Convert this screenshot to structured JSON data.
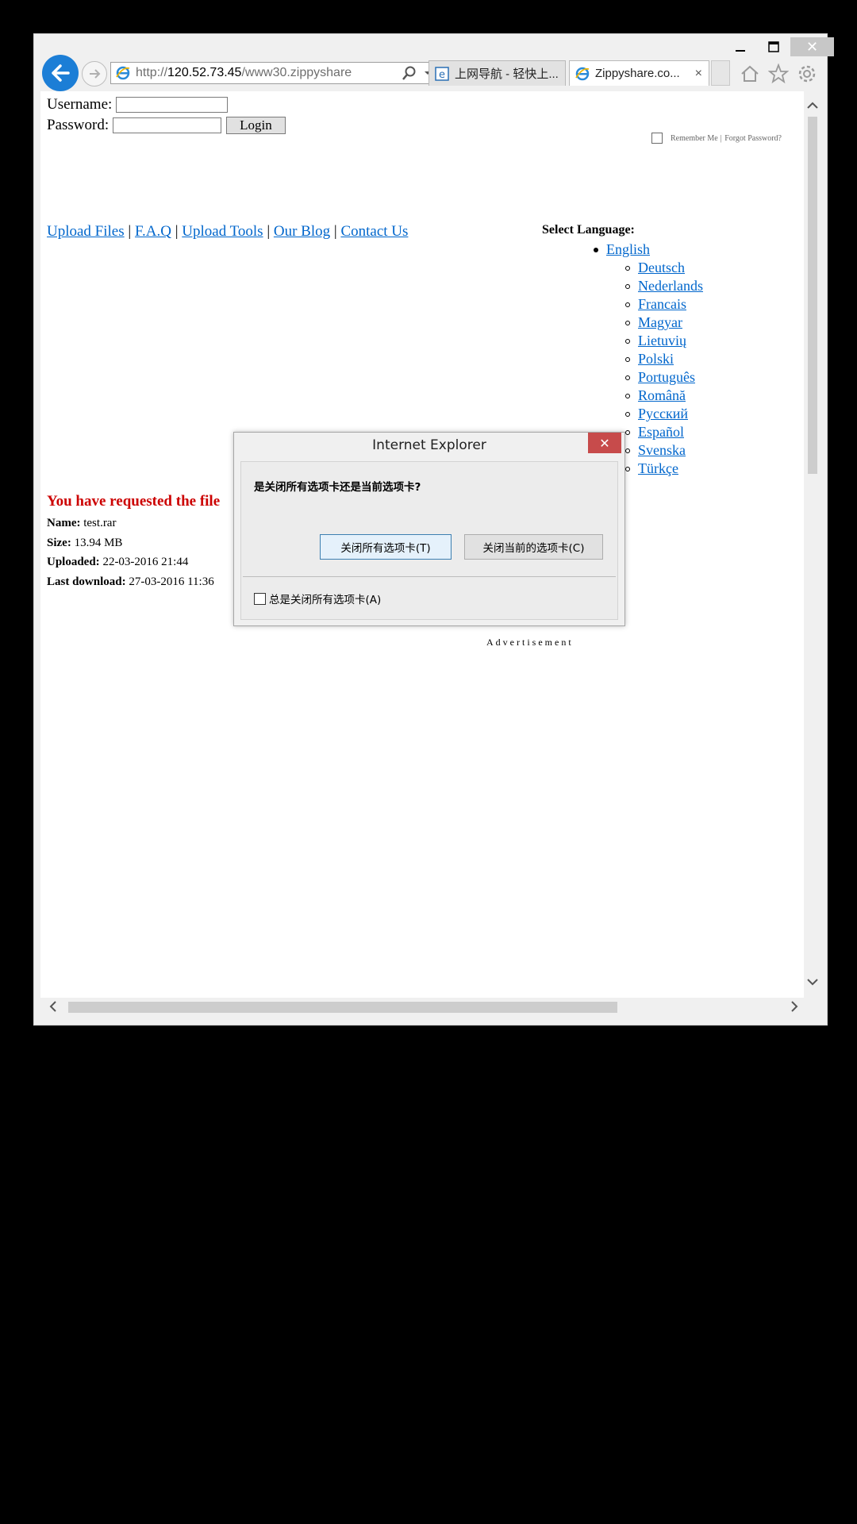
{
  "browser": {
    "address": {
      "url_prefix": "http://",
      "url_host": "120.52.73.45",
      "url_path": "/www30.zippyshare"
    },
    "tabs": [
      {
        "label": "上网导航 - 轻快上...",
        "active": false
      },
      {
        "label": "Zippyshare.co...",
        "active": true
      }
    ],
    "tab_close": "×",
    "window_controls": {
      "minimize": "—",
      "maximize": "☐",
      "close": "✕"
    }
  },
  "page": {
    "login": {
      "username_label": "Username:",
      "password_label": "Password:",
      "login_button": "Login",
      "remember_me": "Remember Me |",
      "forgot_password": "Forgot Password?"
    },
    "nav": [
      {
        "label": "Upload Files"
      },
      {
        "label": "F.A.Q"
      },
      {
        "label": "Upload Tools"
      },
      {
        "label": "Our Blog"
      },
      {
        "label": "Contact Us"
      }
    ],
    "nav_separator": "|",
    "select_language": "Select Language:",
    "languages": {
      "primary": "English",
      "others": [
        "Deutsch",
        "Nederlands",
        "Francais",
        "Magyar",
        "Lietuvių",
        "Polski",
        "Português",
        "Română",
        "Русский",
        "Español",
        "Svenska",
        "Türkçe"
      ]
    },
    "requested_text": "You have requested the file",
    "file": {
      "name_label": "Name:",
      "name": "test.rar",
      "size_label": "Size:",
      "size": "13.94 MB",
      "uploaded_label": "Uploaded:",
      "uploaded": "22-03-2016 21:44",
      "last_download_label": "Last download:",
      "last_download": "27-03-2016 11:36"
    },
    "advertisement": "Advertisement"
  },
  "dialog": {
    "title": "Internet Explorer",
    "close": "✕",
    "question": "是关闭所有选项卡还是当前选项卡?",
    "btn_close_all": "关闭所有选项卡(T)",
    "btn_close_current": "关闭当前的选项卡(C)",
    "checkbox_label": "总是关闭所有选项卡(A)"
  },
  "colors": {
    "link": "#0066cc",
    "requested": "#cc0000",
    "back_button": "#1c7ed6",
    "dialog_close": "#c74b4b"
  },
  "icons": [
    "back-arrow-icon",
    "forward-arrow-icon",
    "ie-logo-icon",
    "search-icon",
    "dropdown-icon",
    "refresh-icon",
    "home-icon",
    "favorites-star-icon",
    "settings-gear-icon"
  ]
}
